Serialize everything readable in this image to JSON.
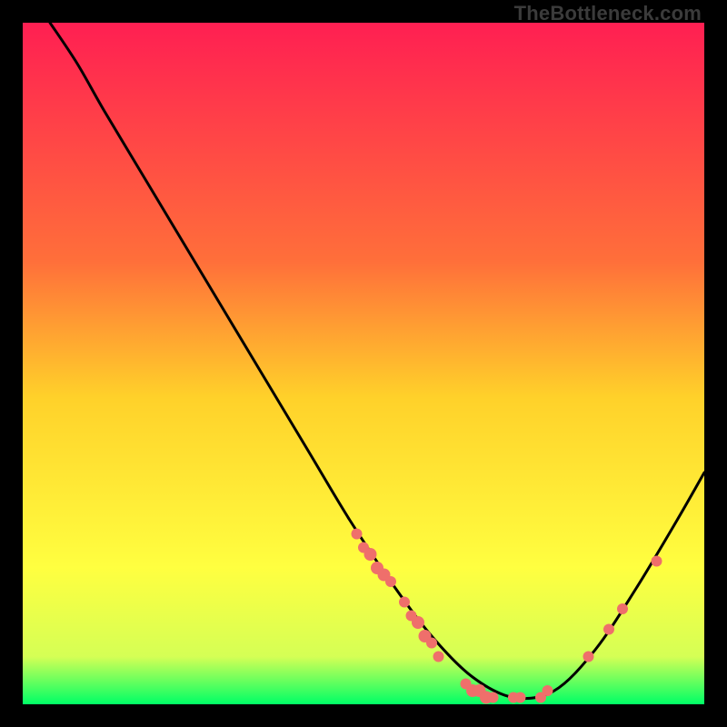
{
  "watermark": "TheBottleneck.com",
  "chart_data": {
    "type": "line",
    "title": "",
    "xlabel": "",
    "ylabel": "",
    "xlim": [
      0,
      100
    ],
    "ylim": [
      0,
      100
    ],
    "grid": false,
    "legend": false,
    "gradient_stops": [
      {
        "offset": 0,
        "color": "#ff1f52"
      },
      {
        "offset": 35,
        "color": "#ff6f3a"
      },
      {
        "offset": 55,
        "color": "#ffd12a"
      },
      {
        "offset": 80,
        "color": "#ffff40"
      },
      {
        "offset": 93,
        "color": "#d5ff55"
      },
      {
        "offset": 100,
        "color": "#00ff66"
      }
    ],
    "series": [
      {
        "name": "bottleneck-curve",
        "color": "#000000",
        "points": [
          {
            "x": 4,
            "y": 100
          },
          {
            "x": 8,
            "y": 94
          },
          {
            "x": 12,
            "y": 87
          },
          {
            "x": 18,
            "y": 77
          },
          {
            "x": 24,
            "y": 67
          },
          {
            "x": 30,
            "y": 57
          },
          {
            "x": 36,
            "y": 47
          },
          {
            "x": 42,
            "y": 37
          },
          {
            "x": 48,
            "y": 27
          },
          {
            "x": 54,
            "y": 18
          },
          {
            "x": 60,
            "y": 10
          },
          {
            "x": 66,
            "y": 4
          },
          {
            "x": 72,
            "y": 1
          },
          {
            "x": 78,
            "y": 2
          },
          {
            "x": 84,
            "y": 8
          },
          {
            "x": 90,
            "y": 17
          },
          {
            "x": 96,
            "y": 27
          },
          {
            "x": 100,
            "y": 34
          }
        ]
      }
    ],
    "markers": {
      "color": "#ef6f6b",
      "points": [
        {
          "x": 49,
          "y": 25,
          "r": 6
        },
        {
          "x": 50,
          "y": 23,
          "r": 6
        },
        {
          "x": 51,
          "y": 22,
          "r": 7
        },
        {
          "x": 52,
          "y": 20,
          "r": 7
        },
        {
          "x": 53,
          "y": 19,
          "r": 7
        },
        {
          "x": 54,
          "y": 18,
          "r": 6
        },
        {
          "x": 56,
          "y": 15,
          "r": 6
        },
        {
          "x": 57,
          "y": 13,
          "r": 6
        },
        {
          "x": 58,
          "y": 12,
          "r": 7
        },
        {
          "x": 59,
          "y": 10,
          "r": 7
        },
        {
          "x": 60,
          "y": 9,
          "r": 6
        },
        {
          "x": 61,
          "y": 7,
          "r": 6
        },
        {
          "x": 65,
          "y": 3,
          "r": 6
        },
        {
          "x": 66,
          "y": 2,
          "r": 7
        },
        {
          "x": 67,
          "y": 2,
          "r": 7
        },
        {
          "x": 68,
          "y": 1,
          "r": 7
        },
        {
          "x": 69,
          "y": 1,
          "r": 6
        },
        {
          "x": 72,
          "y": 1,
          "r": 6
        },
        {
          "x": 73,
          "y": 1,
          "r": 6
        },
        {
          "x": 76,
          "y": 1,
          "r": 6
        },
        {
          "x": 77,
          "y": 2,
          "r": 6
        },
        {
          "x": 83,
          "y": 7,
          "r": 6
        },
        {
          "x": 86,
          "y": 11,
          "r": 6
        },
        {
          "x": 88,
          "y": 14,
          "r": 6
        },
        {
          "x": 93,
          "y": 21,
          "r": 6
        }
      ]
    }
  }
}
